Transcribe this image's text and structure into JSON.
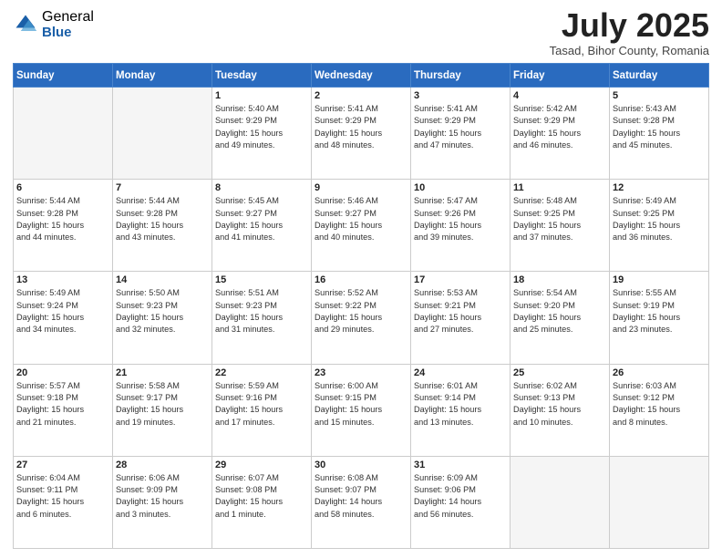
{
  "logo": {
    "general": "General",
    "blue": "Blue"
  },
  "header": {
    "month": "July 2025",
    "location": "Tasad, Bihor County, Romania"
  },
  "weekdays": [
    "Sunday",
    "Monday",
    "Tuesday",
    "Wednesday",
    "Thursday",
    "Friday",
    "Saturday"
  ],
  "weeks": [
    [
      {
        "day": "",
        "empty": true
      },
      {
        "day": "",
        "empty": true
      },
      {
        "day": "1",
        "sunrise": "5:40 AM",
        "sunset": "9:29 PM",
        "daylight": "15 hours and 49 minutes."
      },
      {
        "day": "2",
        "sunrise": "5:41 AM",
        "sunset": "9:29 PM",
        "daylight": "15 hours and 48 minutes."
      },
      {
        "day": "3",
        "sunrise": "5:41 AM",
        "sunset": "9:29 PM",
        "daylight": "15 hours and 47 minutes."
      },
      {
        "day": "4",
        "sunrise": "5:42 AM",
        "sunset": "9:29 PM",
        "daylight": "15 hours and 46 minutes."
      },
      {
        "day": "5",
        "sunrise": "5:43 AM",
        "sunset": "9:28 PM",
        "daylight": "15 hours and 45 minutes."
      }
    ],
    [
      {
        "day": "6",
        "sunrise": "5:44 AM",
        "sunset": "9:28 PM",
        "daylight": "15 hours and 44 minutes."
      },
      {
        "day": "7",
        "sunrise": "5:44 AM",
        "sunset": "9:28 PM",
        "daylight": "15 hours and 43 minutes."
      },
      {
        "day": "8",
        "sunrise": "5:45 AM",
        "sunset": "9:27 PM",
        "daylight": "15 hours and 41 minutes."
      },
      {
        "day": "9",
        "sunrise": "5:46 AM",
        "sunset": "9:27 PM",
        "daylight": "15 hours and 40 minutes."
      },
      {
        "day": "10",
        "sunrise": "5:47 AM",
        "sunset": "9:26 PM",
        "daylight": "15 hours and 39 minutes."
      },
      {
        "day": "11",
        "sunrise": "5:48 AM",
        "sunset": "9:25 PM",
        "daylight": "15 hours and 37 minutes."
      },
      {
        "day": "12",
        "sunrise": "5:49 AM",
        "sunset": "9:25 PM",
        "daylight": "15 hours and 36 minutes."
      }
    ],
    [
      {
        "day": "13",
        "sunrise": "5:49 AM",
        "sunset": "9:24 PM",
        "daylight": "15 hours and 34 minutes."
      },
      {
        "day": "14",
        "sunrise": "5:50 AM",
        "sunset": "9:23 PM",
        "daylight": "15 hours and 32 minutes."
      },
      {
        "day": "15",
        "sunrise": "5:51 AM",
        "sunset": "9:23 PM",
        "daylight": "15 hours and 31 minutes."
      },
      {
        "day": "16",
        "sunrise": "5:52 AM",
        "sunset": "9:22 PM",
        "daylight": "15 hours and 29 minutes."
      },
      {
        "day": "17",
        "sunrise": "5:53 AM",
        "sunset": "9:21 PM",
        "daylight": "15 hours and 27 minutes."
      },
      {
        "day": "18",
        "sunrise": "5:54 AM",
        "sunset": "9:20 PM",
        "daylight": "15 hours and 25 minutes."
      },
      {
        "day": "19",
        "sunrise": "5:55 AM",
        "sunset": "9:19 PM",
        "daylight": "15 hours and 23 minutes."
      }
    ],
    [
      {
        "day": "20",
        "sunrise": "5:57 AM",
        "sunset": "9:18 PM",
        "daylight": "15 hours and 21 minutes."
      },
      {
        "day": "21",
        "sunrise": "5:58 AM",
        "sunset": "9:17 PM",
        "daylight": "15 hours and 19 minutes."
      },
      {
        "day": "22",
        "sunrise": "5:59 AM",
        "sunset": "9:16 PM",
        "daylight": "15 hours and 17 minutes."
      },
      {
        "day": "23",
        "sunrise": "6:00 AM",
        "sunset": "9:15 PM",
        "daylight": "15 hours and 15 minutes."
      },
      {
        "day": "24",
        "sunrise": "6:01 AM",
        "sunset": "9:14 PM",
        "daylight": "15 hours and 13 minutes."
      },
      {
        "day": "25",
        "sunrise": "6:02 AM",
        "sunset": "9:13 PM",
        "daylight": "15 hours and 10 minutes."
      },
      {
        "day": "26",
        "sunrise": "6:03 AM",
        "sunset": "9:12 PM",
        "daylight": "15 hours and 8 minutes."
      }
    ],
    [
      {
        "day": "27",
        "sunrise": "6:04 AM",
        "sunset": "9:11 PM",
        "daylight": "15 hours and 6 minutes."
      },
      {
        "day": "28",
        "sunrise": "6:06 AM",
        "sunset": "9:09 PM",
        "daylight": "15 hours and 3 minutes."
      },
      {
        "day": "29",
        "sunrise": "6:07 AM",
        "sunset": "9:08 PM",
        "daylight": "15 hours and 1 minute."
      },
      {
        "day": "30",
        "sunrise": "6:08 AM",
        "sunset": "9:07 PM",
        "daylight": "14 hours and 58 minutes."
      },
      {
        "day": "31",
        "sunrise": "6:09 AM",
        "sunset": "9:06 PM",
        "daylight": "14 hours and 56 minutes."
      },
      {
        "day": "",
        "empty": true
      },
      {
        "day": "",
        "empty": true
      }
    ]
  ],
  "labels": {
    "sunrise": "Sunrise:",
    "sunset": "Sunset:",
    "daylight": "Daylight:"
  }
}
